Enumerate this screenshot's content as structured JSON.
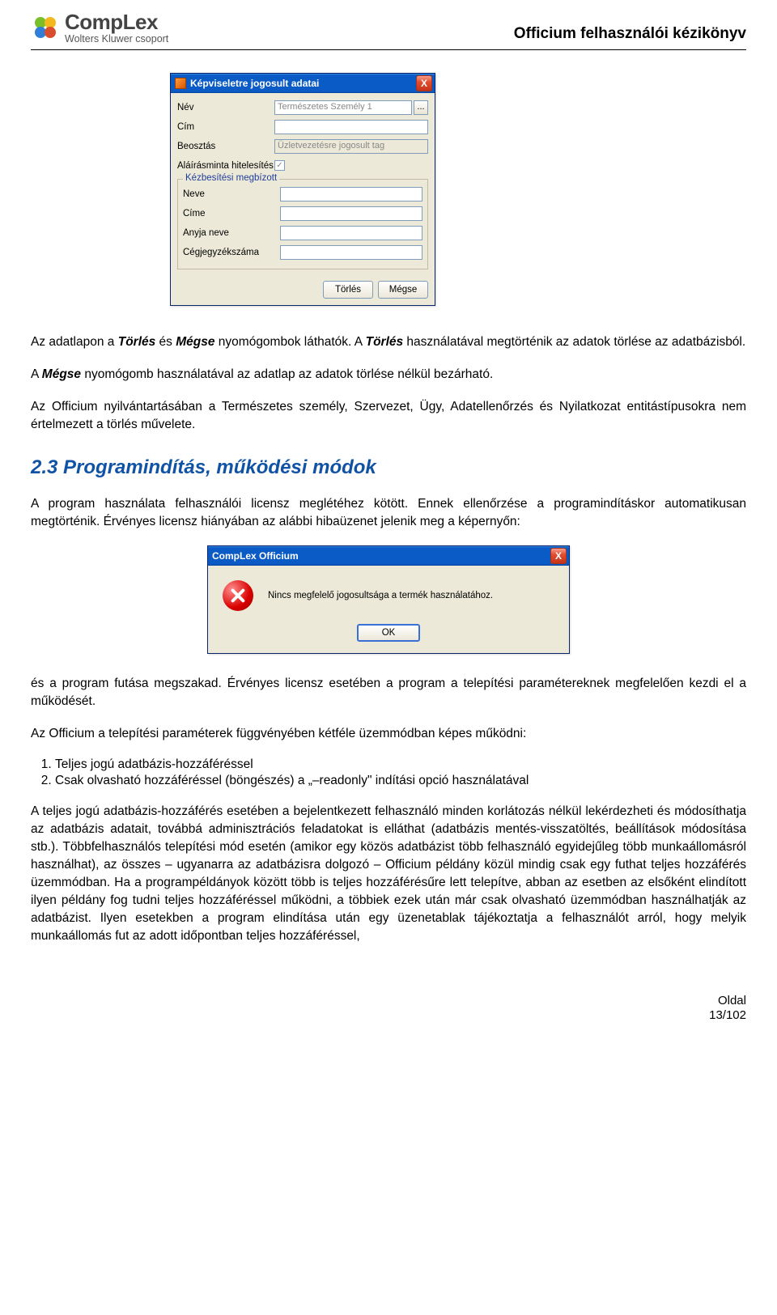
{
  "header": {
    "logo_main": "CompLex",
    "logo_sub": "Wolters Kluwer csoport",
    "title": "Officium felhasználói kézikönyv"
  },
  "dialog1": {
    "title": "Képviseletre jogosult adatai",
    "close": "X",
    "rows": {
      "nev_label": "Név",
      "nev_value": "Természetes Személy 1",
      "browse": "...",
      "cim_label": "Cím",
      "beosztas_label": "Beosztás",
      "beosztas_value": "Üzletvezetésre jogosult tag",
      "alairas_label": "Aláírásminta hitelesítés",
      "alairas_check": "✓"
    },
    "fieldset": {
      "legend": "Kézbesítési megbízott",
      "neve": "Neve",
      "cime": "Címe",
      "anyja": "Anyja neve",
      "ceg": "Cégjegyzékszáma"
    },
    "buttons": {
      "torles": "Törlés",
      "megse": "Mégse"
    }
  },
  "para1_a": "Az adatlapon a ",
  "para1_b": "Törlés",
  "para1_c": " és ",
  "para1_d": "Mégse",
  "para1_e": " nyomógombok láthatók. A ",
  "para1_f": "Törlés",
  "para1_g": " használatával megtörténik az adatok törlése az adatbázisból.",
  "para2_a": "A ",
  "para2_b": "Mégse",
  "para2_c": " nyomógomb használatával az adatlap az adatok törlése nélkül bezárható.",
  "para3": "Az Officium nyilvántartásában a Természetes személy, Szervezet, Ügy, Adatellenőrzés és Nyilatkozat entitástípusokra nem értelmezett a törlés művelete.",
  "h2": "2.3 Programindítás, működési módok",
  "para4": "A program használata felhasználói licensz meglétéhez kötött. Ennek ellenőrzése a programindításkor automatikusan megtörténik. Érvényes licensz hiányában az alábbi hibaüzenet jelenik meg a képernyőn:",
  "msgbox": {
    "title": "CompLex Officium",
    "text": "Nincs megfelelő jogosultsága a termék használatához.",
    "ok": "OK"
  },
  "para5": "és a program futása megszakad. Érvényes licensz esetében a program a telepítési paramétereknek megfelelően kezdi el a működését.",
  "para6": "Az Officium a telepítési paraméterek függvényében kétféle üzemmódban képes működni:",
  "list": {
    "i1": "Teljes jogú adatbázis-hozzáféréssel",
    "i2": "Csak olvasható hozzáféréssel (böngészés) a „–readonly\" indítási opció használatával"
  },
  "para7": "A teljes jogú adatbázis-hozzáférés esetében a bejelentkezett felhasználó minden korlátozás nélkül lekérdezheti és módosíthatja az adatbázis adatait, továbbá adminisztrációs feladatokat is elláthat (adatbázis mentés-visszatöltés, beállítások módosítása stb.). Többfelhasználós telepítési mód esetén (amikor egy közös adatbázist több felhasználó egyidejűleg több munkaállomásról használhat), az összes – ugyanarra az adatbázisra dolgozó – Officium példány közül mindig csak egy futhat teljes hozzáférés üzemmódban. Ha a programpéldányok között több is teljes hozzáférésűre lett telepítve, abban az esetben az elsőként elindított ilyen példány fog tudni teljes hozzáféréssel működni, a többiek ezek után már csak olvasható üzemmódban használhatják az adatbázist. Ilyen esetekben a program elindítása után egy üzenetablak tájékoztatja a felhasználót arról, hogy melyik munkaállomás fut az adott időpontban teljes hozzáféréssel,",
  "footer": {
    "l1": "Oldal",
    "l2": "13/102"
  }
}
